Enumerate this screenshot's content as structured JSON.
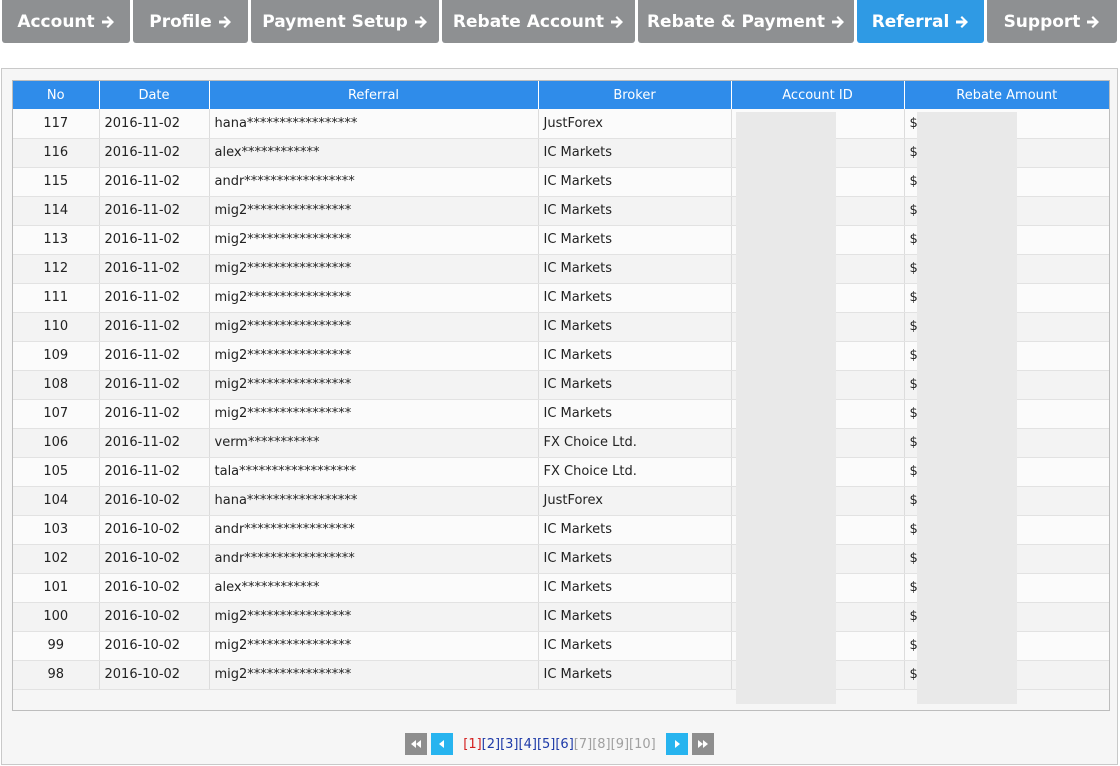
{
  "tabs": [
    {
      "label": "Account",
      "active": false
    },
    {
      "label": "Profile",
      "active": false
    },
    {
      "label": "Payment Setup",
      "active": false
    },
    {
      "label": "Rebate Account",
      "active": false
    },
    {
      "label": "Rebate & Payment",
      "active": false
    },
    {
      "label": "Referral",
      "active": true
    },
    {
      "label": "Support",
      "active": false
    }
  ],
  "table": {
    "headers": [
      "No",
      "Date",
      "Referral",
      "Broker",
      "Account ID",
      "Rebate Amount"
    ],
    "currency_prefix": "$",
    "rows": [
      {
        "no": "117",
        "date": "2016-11-02",
        "referral": "hana*****************",
        "broker": "JustForex"
      },
      {
        "no": "116",
        "date": "2016-11-02",
        "referral": "alex************",
        "broker": "IC Markets"
      },
      {
        "no": "115",
        "date": "2016-11-02",
        "referral": "andr*****************",
        "broker": "IC Markets"
      },
      {
        "no": "114",
        "date": "2016-11-02",
        "referral": "mig2****************",
        "broker": "IC Markets"
      },
      {
        "no": "113",
        "date": "2016-11-02",
        "referral": "mig2****************",
        "broker": "IC Markets"
      },
      {
        "no": "112",
        "date": "2016-11-02",
        "referral": "mig2****************",
        "broker": "IC Markets"
      },
      {
        "no": "111",
        "date": "2016-11-02",
        "referral": "mig2****************",
        "broker": "IC Markets"
      },
      {
        "no": "110",
        "date": "2016-11-02",
        "referral": "mig2****************",
        "broker": "IC Markets"
      },
      {
        "no": "109",
        "date": "2016-11-02",
        "referral": "mig2****************",
        "broker": "IC Markets"
      },
      {
        "no": "108",
        "date": "2016-11-02",
        "referral": "mig2****************",
        "broker": "IC Markets"
      },
      {
        "no": "107",
        "date": "2016-11-02",
        "referral": "mig2****************",
        "broker": "IC Markets"
      },
      {
        "no": "106",
        "date": "2016-11-02",
        "referral": "verm***********",
        "broker": "FX Choice Ltd."
      },
      {
        "no": "105",
        "date": "2016-11-02",
        "referral": "tala******************",
        "broker": "FX Choice Ltd."
      },
      {
        "no": "104",
        "date": "2016-10-02",
        "referral": "hana*****************",
        "broker": "JustForex"
      },
      {
        "no": "103",
        "date": "2016-10-02",
        "referral": "andr*****************",
        "broker": "IC Markets"
      },
      {
        "no": "102",
        "date": "2016-10-02",
        "referral": "andr*****************",
        "broker": "IC Markets"
      },
      {
        "no": "101",
        "date": "2016-10-02",
        "referral": "alex************",
        "broker": "IC Markets"
      },
      {
        "no": "100",
        "date": "2016-10-02",
        "referral": "mig2****************",
        "broker": "IC Markets"
      },
      {
        "no": "99",
        "date": "2016-10-02",
        "referral": "mig2****************",
        "broker": "IC Markets"
      },
      {
        "no": "98",
        "date": "2016-10-02",
        "referral": "mig2****************",
        "broker": "IC Markets"
      }
    ]
  },
  "pagination": {
    "pages": [
      {
        "label": "[1]",
        "state": "current"
      },
      {
        "label": "[2]",
        "state": "link"
      },
      {
        "label": "[3]",
        "state": "link"
      },
      {
        "label": "[4]",
        "state": "link"
      },
      {
        "label": "[5]",
        "state": "link"
      },
      {
        "label": "[6]",
        "state": "link"
      },
      {
        "label": "[7]",
        "state": "disabled"
      },
      {
        "label": "[8]",
        "state": "disabled"
      },
      {
        "label": "[9]",
        "state": "disabled"
      },
      {
        "label": "[10]",
        "state": "disabled"
      }
    ]
  },
  "colors": {
    "tab_inactive": "#8e9092",
    "tab_active": "#2f9ae4",
    "header_blue": "#2f8cea",
    "page_current": "#d42020",
    "page_link": "#1e3aa8",
    "page_disabled": "#a0a0a0",
    "pager_blue": "#27b4ef",
    "pager_grey": "#8e8e8e"
  },
  "icons": {
    "tab_arrow": "arrow-right-icon",
    "first": "double-chevron-left-icon",
    "prev": "triangle-left-icon",
    "next": "triangle-right-icon",
    "last": "double-chevron-right-icon"
  }
}
